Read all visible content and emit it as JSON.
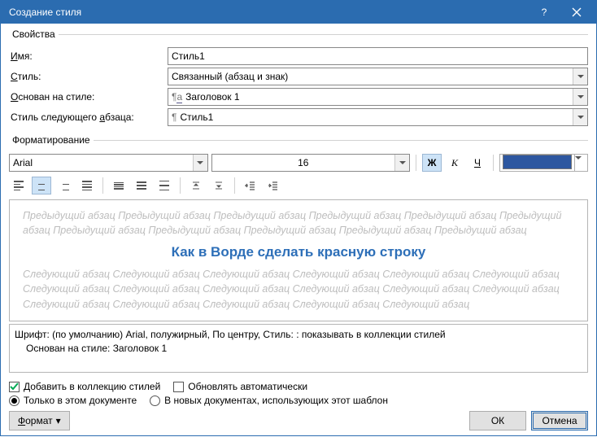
{
  "titlebar": {
    "title": "Создание стиля"
  },
  "props": {
    "legend": "Свойства",
    "name_label": "Имя:",
    "name_value": "Стиль1",
    "type_label": "Стиль:",
    "type_value": "Связанный (абзац и знак)",
    "based_label": "Основан на стиле:",
    "based_value": "Заголовок 1",
    "next_label": "Стиль следующего абзаца:",
    "next_value": "Стиль1"
  },
  "format": {
    "legend": "Форматирование",
    "font": "Arial",
    "size": "16",
    "bold": "Ж",
    "italic": "К",
    "underline": "Ч"
  },
  "preview": {
    "prev": "Предыдущий абзац Предыдущий абзац Предыдущий абзац Предыдущий абзац Предыдущий абзац Предыдущий абзац Предыдущий абзац Предыдущий абзац Предыдущий абзац Предыдущий абзац Предыдущий абзац",
    "sample": "Как в Ворде сделать красную строку",
    "next": "Следующий абзац Следующий абзац Следующий абзац Следующий абзац Следующий абзац Следующий абзац Следующий абзац Следующий абзац Следующий абзац Следующий абзац Следующий абзац Следующий абзац Следующий абзац Следующий абзац Следующий абзац Следующий абзац Следующий абзац"
  },
  "desc": {
    "line1": "Шрифт: (по умолчанию) Arial, полужирный, По центру, Стиль: : показывать в коллекции стилей",
    "line2": "Основан на стиле: Заголовок 1"
  },
  "checks": {
    "add": "Добавить в коллекцию стилей",
    "auto": "Обновлять автоматически",
    "thisdoc": "Только в этом документе",
    "template": "В новых документах, использующих этот шаблон"
  },
  "buttons": {
    "format": "Формат",
    "ok": "ОК",
    "cancel": "Отмена"
  }
}
